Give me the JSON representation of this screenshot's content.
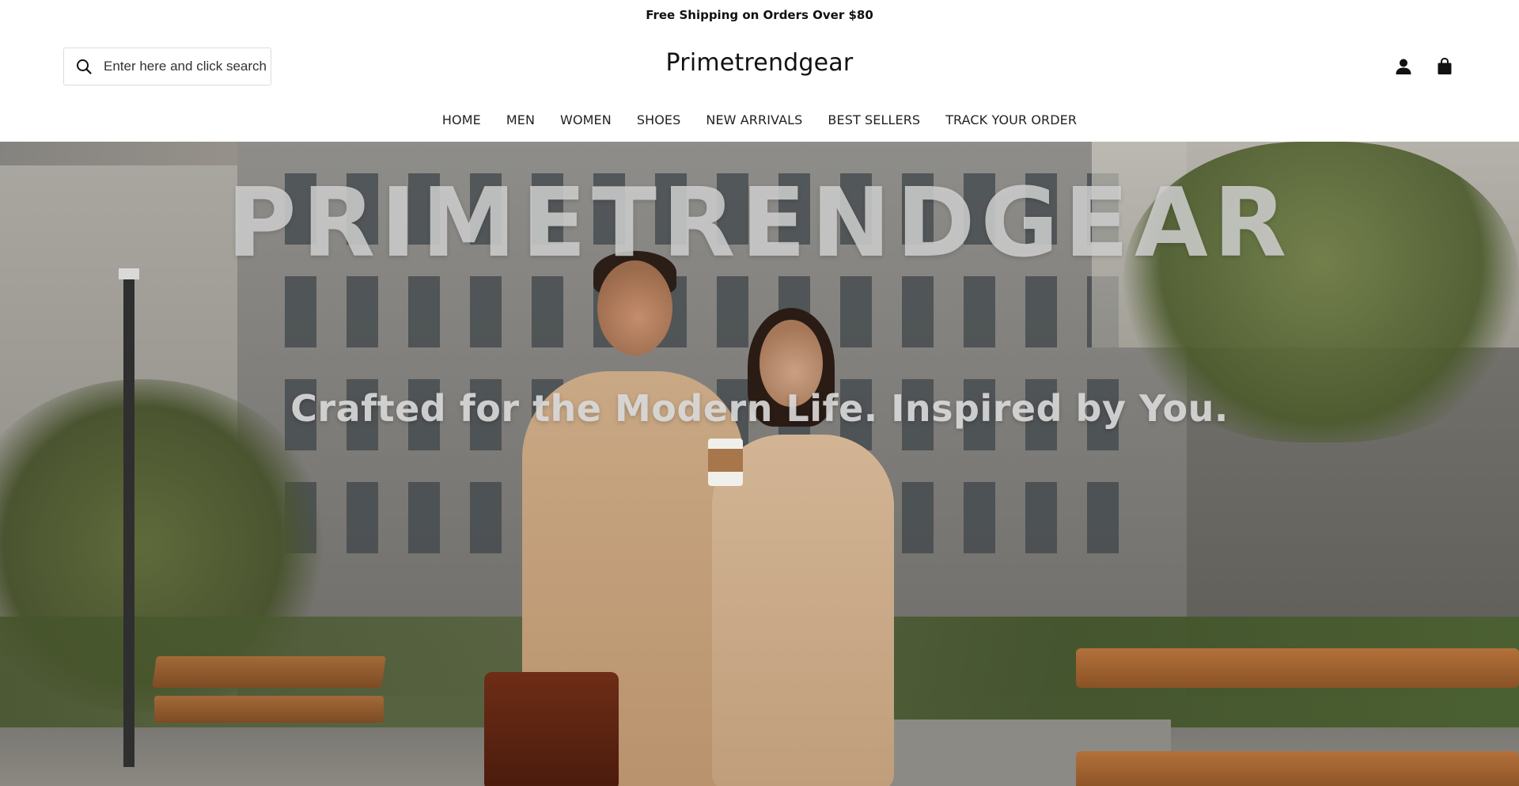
{
  "announcement": {
    "text": "Free Shipping on Orders Over $80"
  },
  "header": {
    "logo": "Primetrendgear",
    "search": {
      "placeholder": "Enter here and click search",
      "value": "",
      "icon": "search-icon"
    },
    "icons": [
      {
        "name": "account-icon",
        "label": "Account"
      },
      {
        "name": "cart-icon",
        "label": "Cart"
      }
    ]
  },
  "nav": {
    "items": [
      {
        "label": "HOME"
      },
      {
        "label": "MEN"
      },
      {
        "label": "WOMEN"
      },
      {
        "label": "SHOES"
      },
      {
        "label": "NEW ARRIVALS"
      },
      {
        "label": "BEST SELLERS"
      },
      {
        "label": "TRACK YOUR ORDER"
      }
    ]
  },
  "hero": {
    "title": "PRIMETRENDGEAR",
    "tagline": "Crafted for the Modern Life. Inspired by You."
  }
}
